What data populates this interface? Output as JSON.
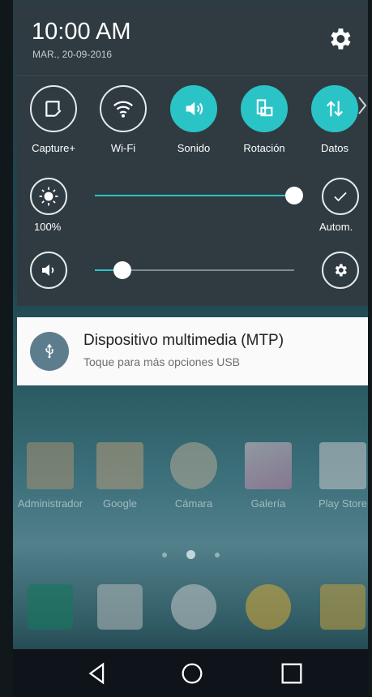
{
  "status": {
    "time": "10:00 AM",
    "date": "MAR., 20-09-2016"
  },
  "shade": {
    "settings_icon": "gear-icon",
    "tiles": [
      {
        "label": "Capture+",
        "icon": "capture-plus-icon",
        "active": false
      },
      {
        "label": "Wi-Fi",
        "icon": "wifi-icon",
        "active": false
      },
      {
        "label": "Sonido",
        "icon": "volume-icon",
        "active": true
      },
      {
        "label": "Rotación",
        "icon": "rotation-icon",
        "active": true
      },
      {
        "label": "Datos",
        "icon": "data-arrows-icon",
        "active": true
      }
    ],
    "brightness": {
      "value_label": "100%",
      "level": 1.0,
      "auto_label": "Autom."
    },
    "volume": {
      "level": 0.14
    }
  },
  "notification": {
    "icon": "usb-icon",
    "title": "Dispositivo multimedia (MTP)",
    "subtitle": "Toque para más opciones USB"
  },
  "home": {
    "apps": [
      {
        "label": "Administrador",
        "icon": "file-manager-icon",
        "color": "#a89070"
      },
      {
        "label": "Google",
        "icon": "google-folder-icon",
        "color": "#b59a78"
      },
      {
        "label": "Cámara",
        "icon": "camera-icon",
        "color": "#b5aa96"
      },
      {
        "label": "Galería",
        "icon": "gallery-icon",
        "color": "#c07aa0"
      },
      {
        "label": "Play Store",
        "icon": "play-store-icon",
        "color": "#c6c8c8"
      }
    ],
    "dock": [
      {
        "icon": "phone-icon",
        "color": "#17775e"
      },
      {
        "icon": "contacts-icon",
        "color": "#a9b0b2"
      },
      {
        "icon": "apps-drawer-icon",
        "color": "#b9c0c2"
      },
      {
        "icon": "chrome-icon",
        "color": "#c9a43a"
      },
      {
        "icon": "messages-icon",
        "color": "#b89a42"
      }
    ]
  },
  "navbar": {
    "back": "back-icon",
    "home": "home-icon",
    "recents": "recents-icon"
  },
  "colors": {
    "accent": "#2ac4c7",
    "shade_bg": "#2f3b41"
  }
}
